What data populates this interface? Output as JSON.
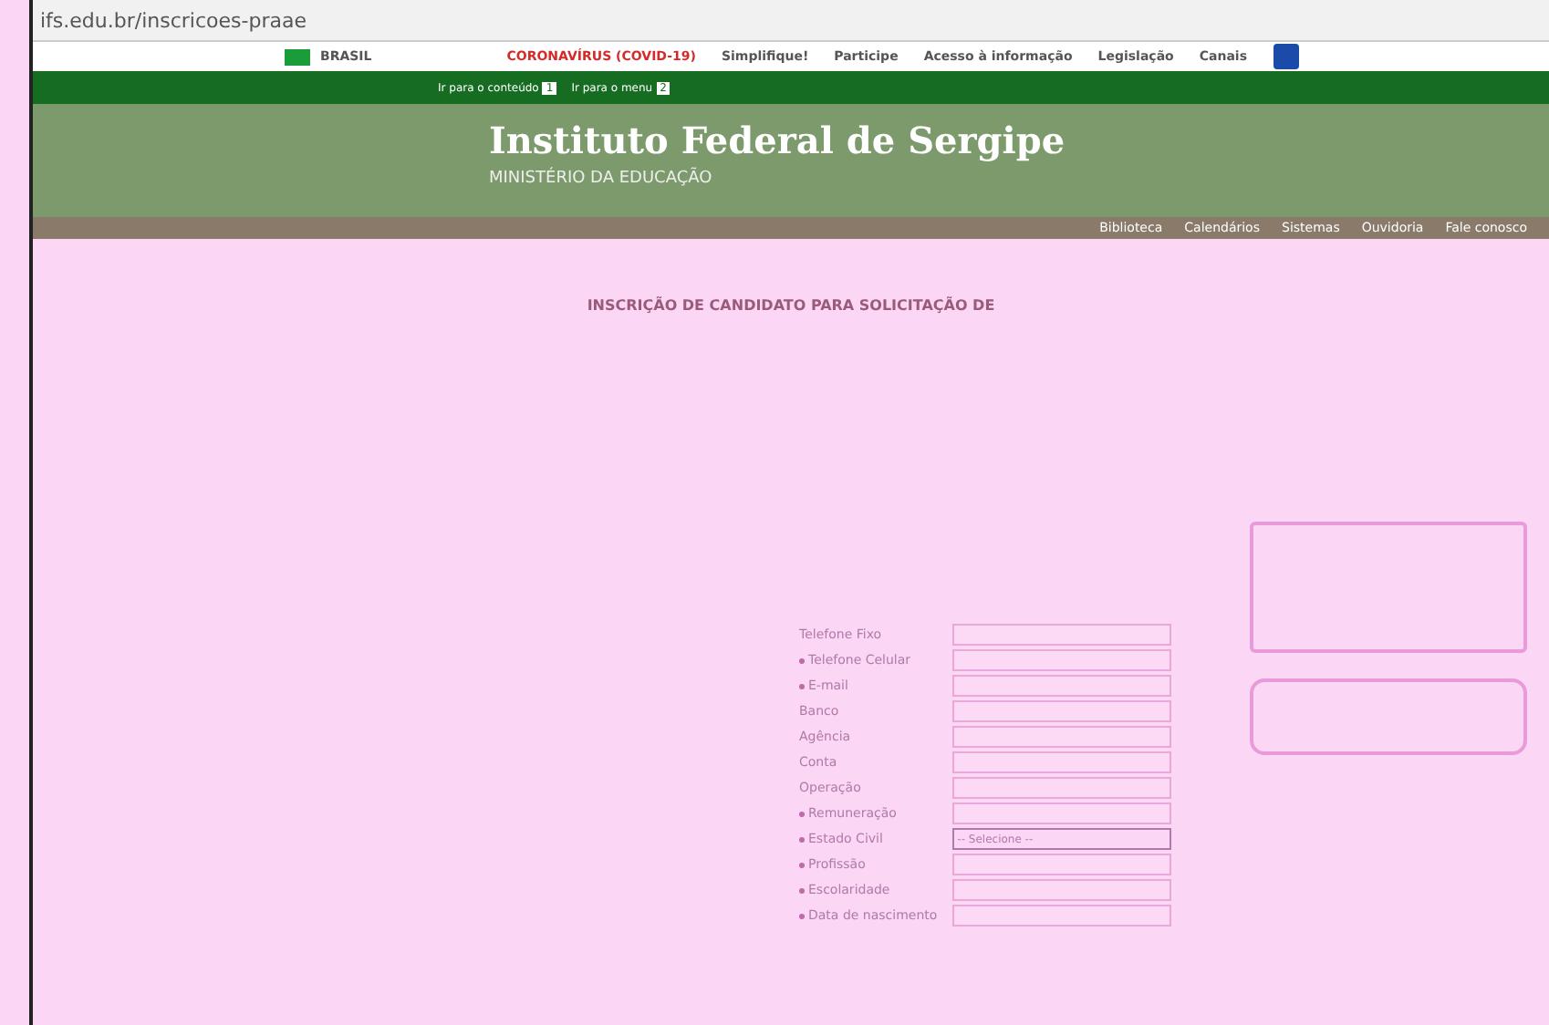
{
  "address_bar": {
    "url": "ifs.edu.br/inscricoes-praae"
  },
  "gov_bar": {
    "country": "BRASIL",
    "links": [
      {
        "label": "CORONAVÍRUS (COVID-19)",
        "kind": "alert"
      },
      {
        "label": "Simplifique!",
        "kind": "normal"
      },
      {
        "label": "Participe",
        "kind": "normal"
      },
      {
        "label": "Acesso à informação",
        "kind": "normal"
      },
      {
        "label": "Legislação",
        "kind": "normal"
      },
      {
        "label": "Canais",
        "kind": "normal"
      }
    ]
  },
  "accessibility_bar": {
    "links": [
      {
        "label": "Ir para o conteúdo",
        "key": "1"
      },
      {
        "label": "Ir para o menu",
        "key": "2"
      }
    ]
  },
  "header": {
    "title": "Instituto Federal de Sergipe",
    "subtitle": "MINISTÉRIO DA EDUCAÇÃO"
  },
  "nav": {
    "items": [
      "Biblioteca",
      "Calendários",
      "Sistemas",
      "Ouvidoria",
      "Fale conosco"
    ]
  },
  "page": {
    "title": "INSCRIÇÃO DE CANDIDATO PARA SOLICITAÇÃO DE"
  },
  "form": {
    "fields": [
      {
        "label": "Telefone Fixo",
        "required": false,
        "kind": "text"
      },
      {
        "label": "Telefone Celular",
        "required": true,
        "kind": "text"
      },
      {
        "label": "E-mail",
        "required": true,
        "kind": "text"
      },
      {
        "label": "Banco",
        "required": false,
        "kind": "text"
      },
      {
        "label": "Agência",
        "required": false,
        "kind": "text"
      },
      {
        "label": "Conta",
        "required": false,
        "kind": "text"
      },
      {
        "label": "Operação",
        "required": false,
        "kind": "text"
      },
      {
        "label": "Remuneração",
        "required": true,
        "kind": "text"
      },
      {
        "label": "Estado Civil",
        "required": true,
        "kind": "select",
        "value": "-- Selecione --"
      },
      {
        "label": "Profissão",
        "required": true,
        "kind": "text"
      },
      {
        "label": "Escolaridade",
        "required": true,
        "kind": "text"
      },
      {
        "label": "Data de nascimento",
        "required": true,
        "kind": "text"
      }
    ]
  }
}
